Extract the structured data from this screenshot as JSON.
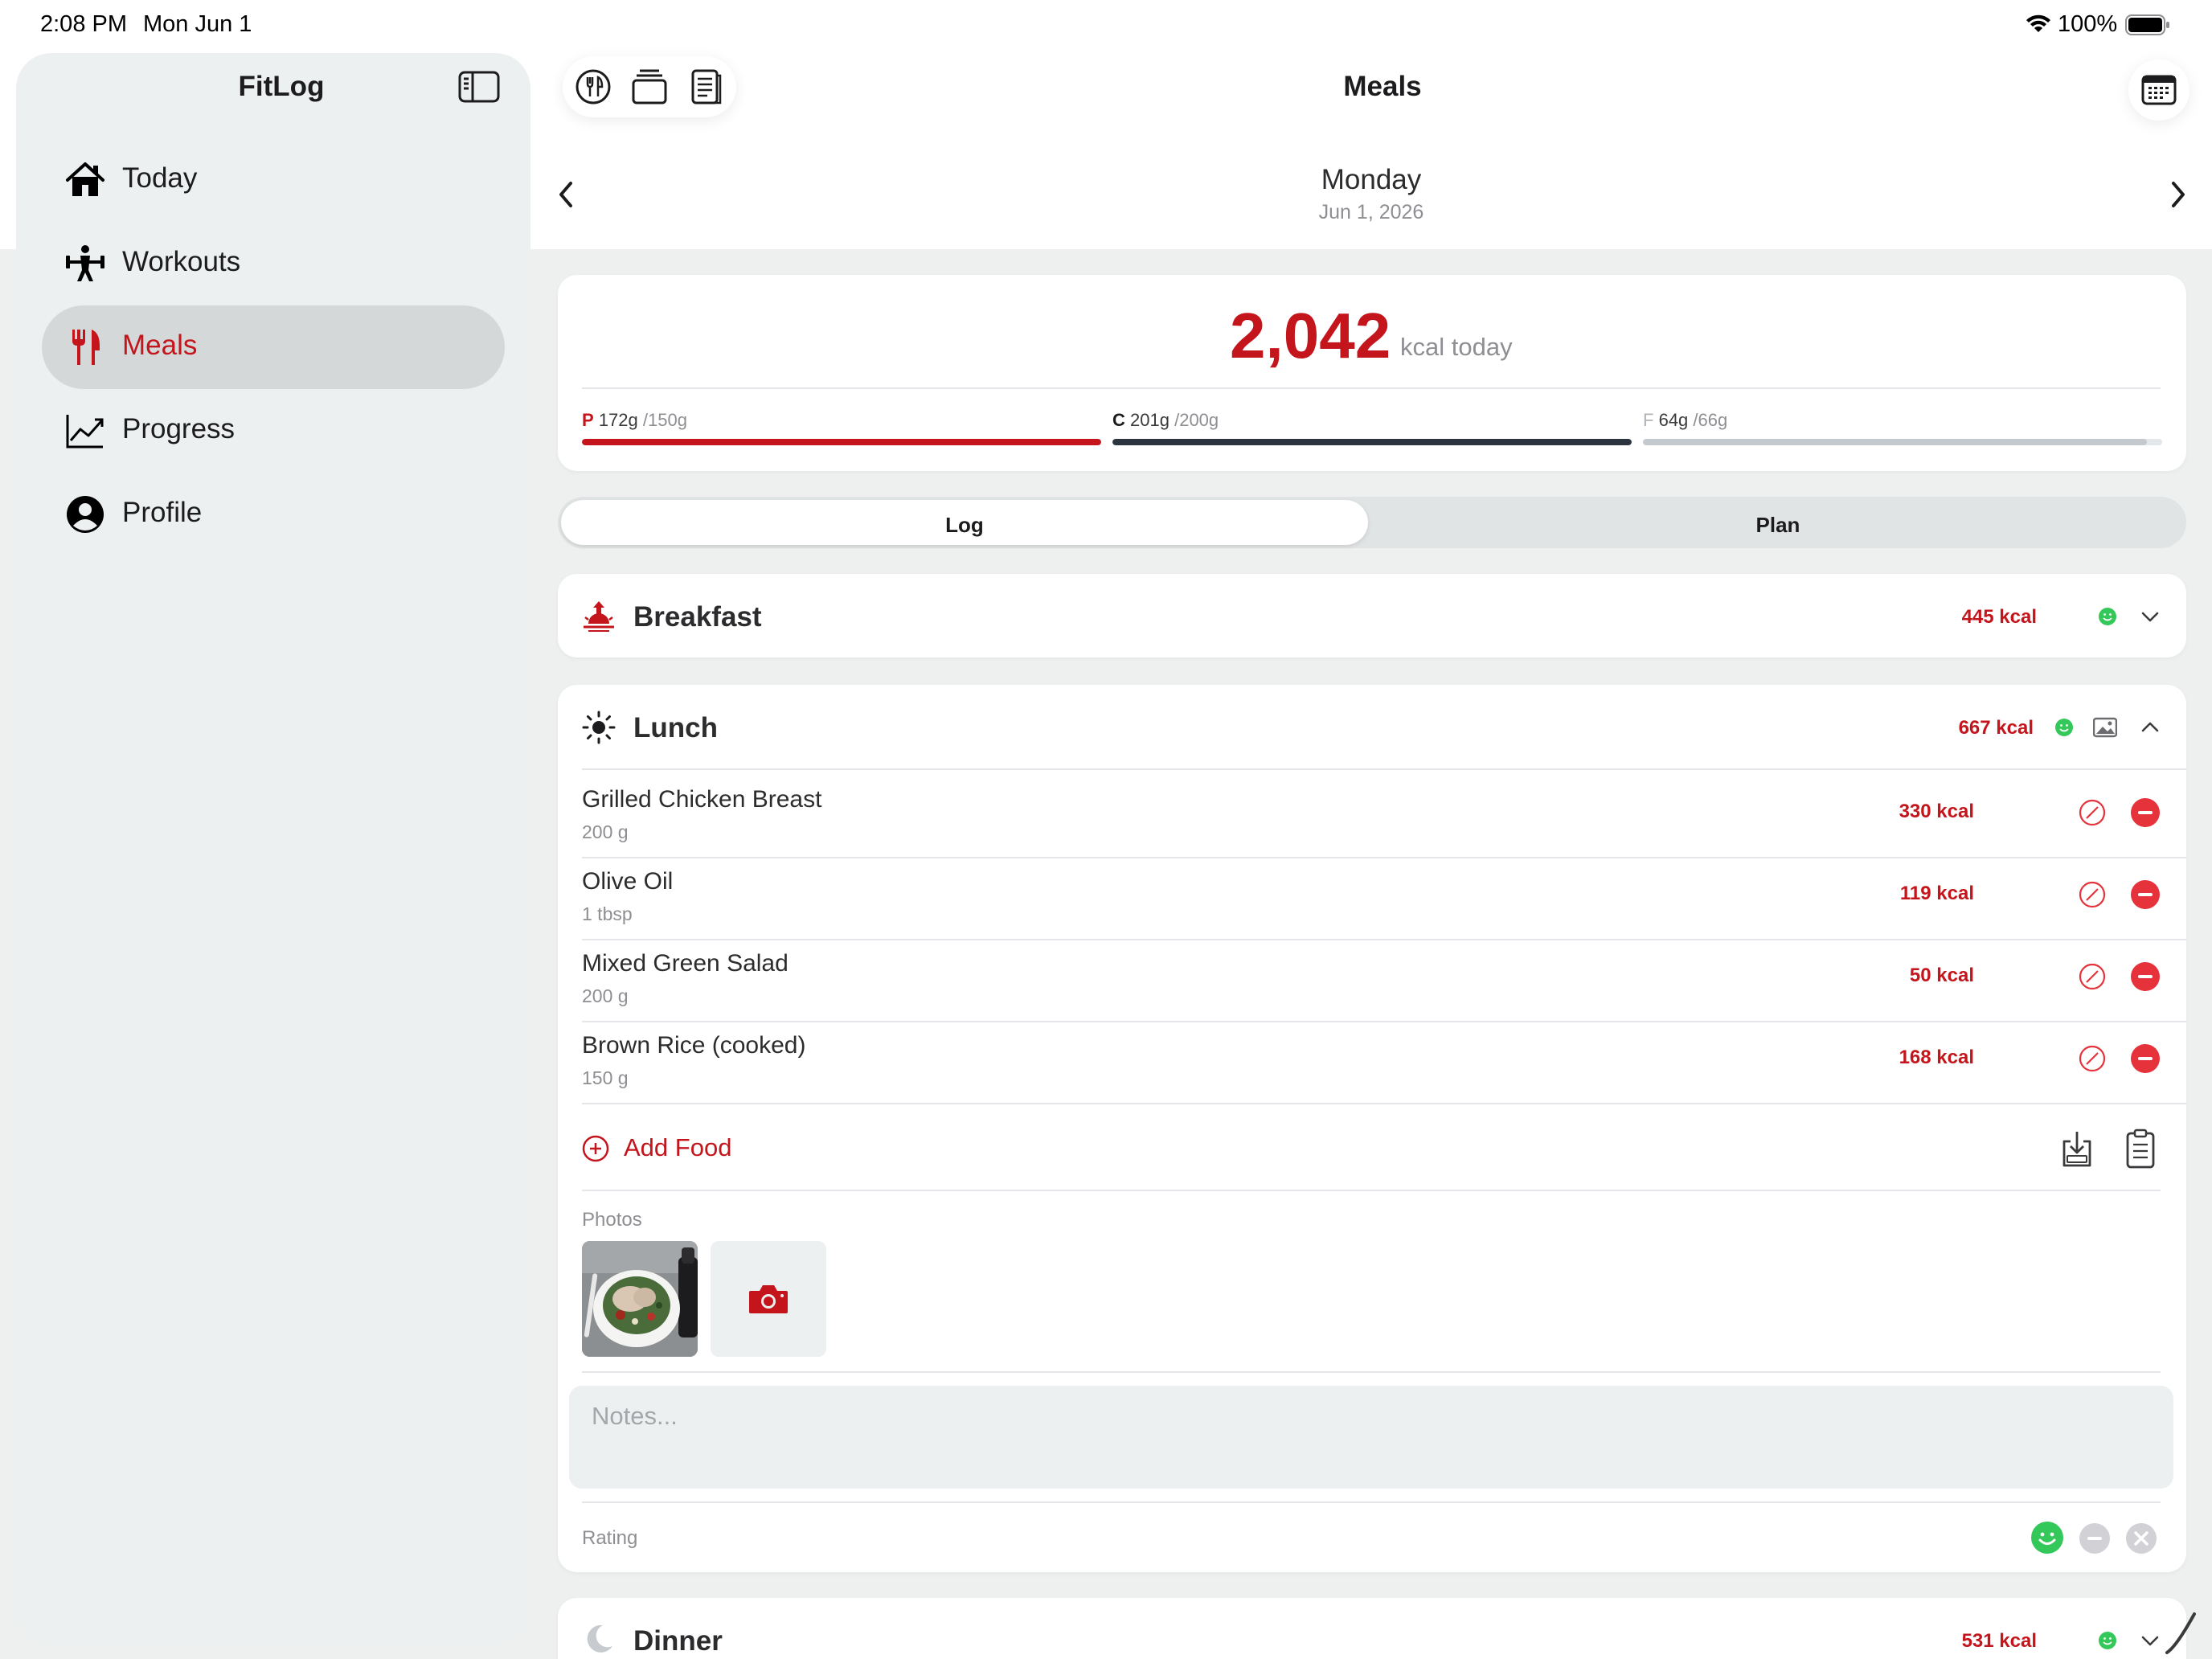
{
  "status_bar": {
    "time": "2:08 PM",
    "date": "Mon Jun 1",
    "battery": "100%"
  },
  "sidebar": {
    "title": "FitLog",
    "items": [
      {
        "label": "Today",
        "icon": "house-icon",
        "active": false
      },
      {
        "label": "Workouts",
        "icon": "figure-strength-icon",
        "active": false
      },
      {
        "label": "Meals",
        "icon": "fork-knife-icon",
        "active": true
      },
      {
        "label": "Progress",
        "icon": "chart-line-icon",
        "active": false
      },
      {
        "label": "Profile",
        "icon": "person-circle-icon",
        "active": false
      }
    ]
  },
  "header": {
    "title": "Meals",
    "day_name": "Monday",
    "date": "Jun 1, 2026",
    "toolbar_icons": [
      "meals-icon",
      "stack-icon",
      "notes-icon"
    ]
  },
  "summary": {
    "kcal": "2,042",
    "kcal_unit": "kcal today",
    "macros": [
      {
        "letter": "P",
        "value": "172g",
        "target": "/150g",
        "fraction": 1.0,
        "color": "#c3151b"
      },
      {
        "letter": "C",
        "value": "201g",
        "target": "/200g",
        "fraction": 1.0,
        "color": "#2c3440"
      },
      {
        "letter": "F",
        "value": "64g",
        "target": "/66g",
        "fraction": 0.97,
        "color": "#c4c9ce"
      }
    ]
  },
  "segments": {
    "log": "Log",
    "plan": "Plan",
    "selected": "Log"
  },
  "meals": {
    "breakfast": {
      "title": "Breakfast",
      "kcal": "445 kcal",
      "expanded": false
    },
    "lunch": {
      "title": "Lunch",
      "kcal": "667 kcal",
      "expanded": true,
      "foods": [
        {
          "name": "Grilled Chicken Breast",
          "qty": "200 g",
          "kcal": "330 kcal"
        },
        {
          "name": "Olive Oil",
          "qty": "1 tbsp",
          "kcal": "119 kcal"
        },
        {
          "name": "Mixed Green Salad",
          "qty": "200 g",
          "kcal": "50 kcal"
        },
        {
          "name": "Brown Rice (cooked)",
          "qty": "150 g",
          "kcal": "168 kcal"
        }
      ],
      "add_food": "Add Food",
      "photos_label": "Photos",
      "notes_placeholder": "Notes...",
      "rating_label": "Rating"
    },
    "dinner": {
      "title": "Dinner",
      "kcal": "531 kcal",
      "expanded": false
    }
  },
  "colors": {
    "accent": "#c3151b",
    "green": "#34c759",
    "remove": "#e5323b"
  }
}
